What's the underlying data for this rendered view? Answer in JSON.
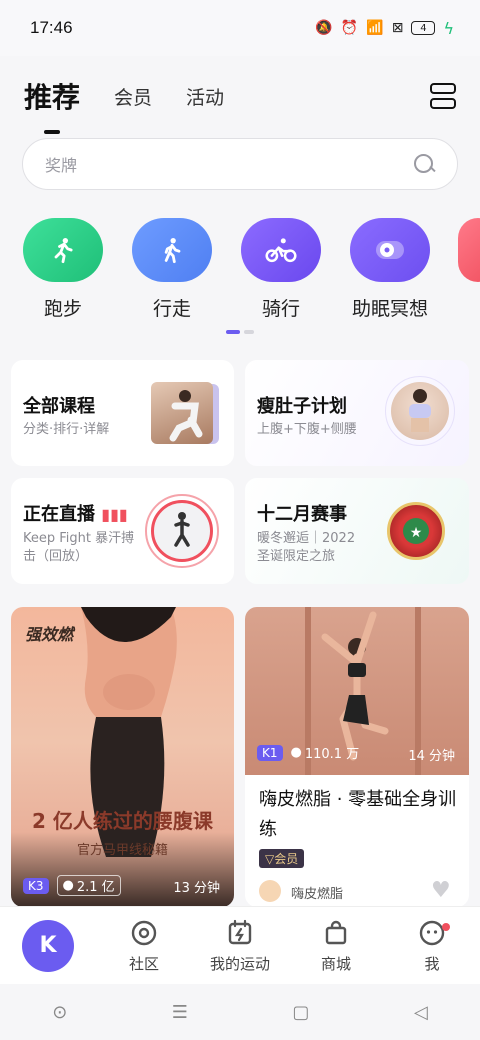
{
  "status": {
    "time": "17:46",
    "battery": "4"
  },
  "tabs": {
    "active": "推荐",
    "others": [
      "会员",
      "活动"
    ]
  },
  "search": {
    "placeholder": "奖牌"
  },
  "quick": [
    {
      "label": "跑步",
      "color": "#2ccf86"
    },
    {
      "label": "行走",
      "color": "#5b8cf7"
    },
    {
      "label": "骑行",
      "color": "#7f5af5"
    },
    {
      "label": "助眠冥想",
      "color": "#7b5ef4"
    }
  ],
  "cards": {
    "all": {
      "title": "全部课程",
      "subtitle": "分类·排行·详解"
    },
    "belly": {
      "title": "瘦肚子计划",
      "subtitle": "上腹+下腹+侧腰"
    },
    "live": {
      "title": "正在直播",
      "subtitle": "Keep Fight 暴汗搏击（回放）"
    },
    "event": {
      "title": "十二月赛事",
      "subtitle": "暖冬邂逅｜2022圣诞限定之旅"
    }
  },
  "feed": {
    "left": {
      "brand": "强效燃",
      "headline": "2 亿人练过的腰腹课",
      "sub": "官方马甲线秘籍",
      "level": "K3",
      "users": "2.1 亿",
      "duration": "13 分钟"
    },
    "right": {
      "level": "K1",
      "users": "110.1 万",
      "duration": "14 分钟",
      "title": "嗨皮燃脂 · 零基础全身训练",
      "badge": "会员",
      "author": "嗨皮燃脂"
    }
  },
  "nav": {
    "home": "K",
    "items": [
      "社区",
      "我的运动",
      "商城",
      "我"
    ]
  }
}
